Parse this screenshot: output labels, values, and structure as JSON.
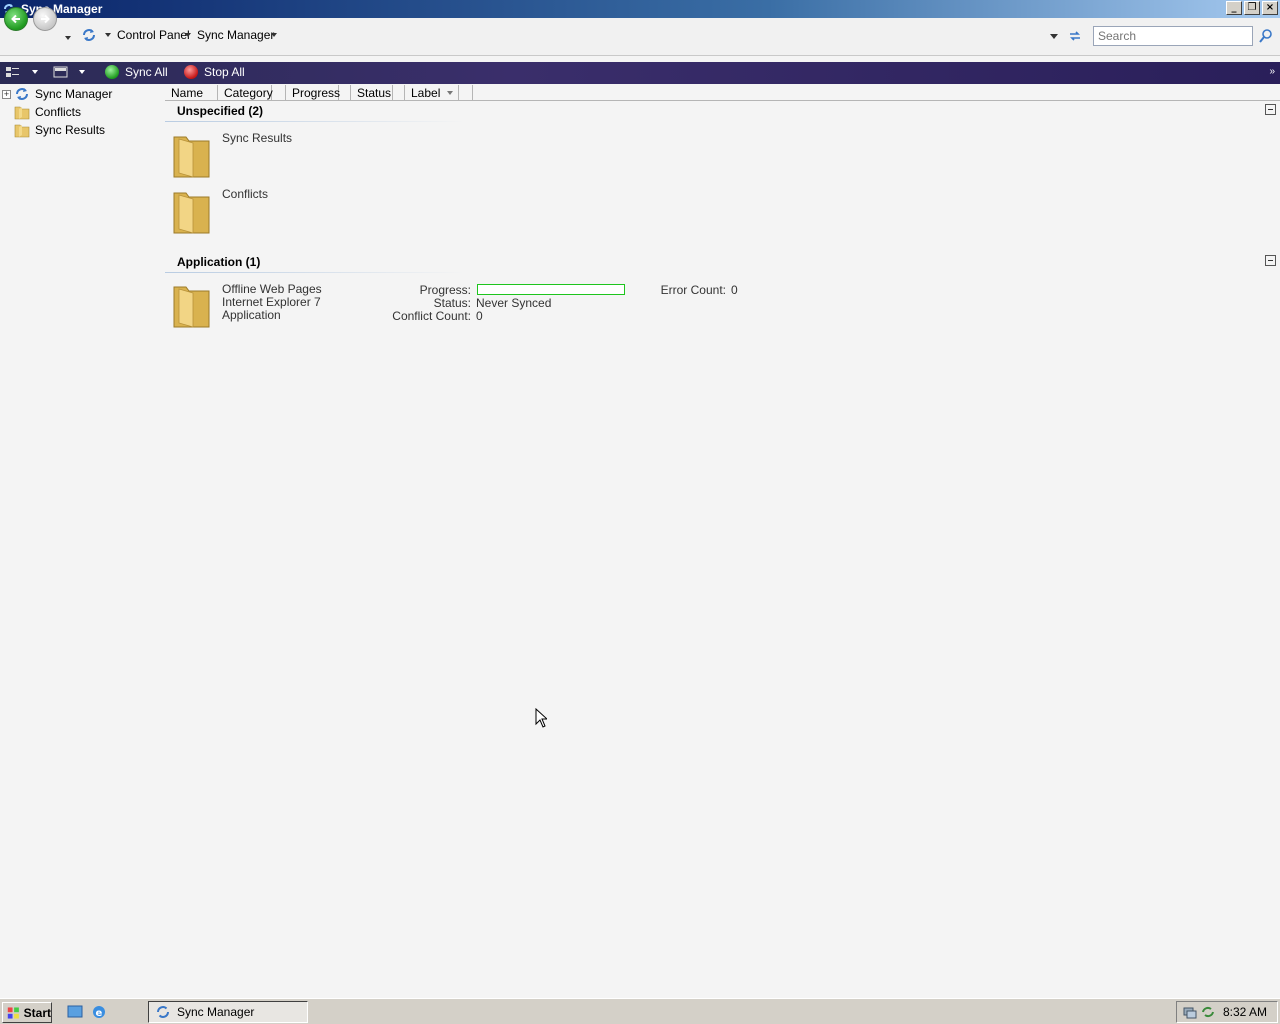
{
  "window": {
    "title": "Sync Manager",
    "controls": [
      "minimize",
      "restore",
      "close"
    ]
  },
  "address_bar": {
    "breadcrumbs": [
      "Control Panel",
      "Sync Manager"
    ],
    "search_placeholder": "Search"
  },
  "toolbar": {
    "sync_all": "Sync All",
    "stop_all": "Stop All"
  },
  "tree": {
    "items": [
      {
        "label": "Sync Manager",
        "icon": "sync-icon"
      },
      {
        "label": "Conflicts",
        "icon": "folder-icon"
      },
      {
        "label": "Sync Results",
        "icon": "folder-icon"
      }
    ]
  },
  "columns": [
    "Name",
    "Category",
    "Progress",
    "Status",
    "Label"
  ],
  "groups": {
    "unspecified": {
      "header": "Unspecified (2)",
      "items": [
        {
          "name": "Sync Results"
        },
        {
          "name": "Conflicts"
        }
      ]
    },
    "application": {
      "header": "Application (1)",
      "item": {
        "name": "Offline Web Pages",
        "subtitle": "Internet Explorer 7",
        "category": "Application",
        "progress_label": "Progress:",
        "progress_value": 0,
        "status_label": "Status:",
        "status_value": "Never Synced",
        "conflict_label": "Conflict Count:",
        "conflict_value": "0",
        "error_label": "Error Count:",
        "error_value": "0"
      }
    }
  },
  "taskbar": {
    "start": "Start",
    "task": "Sync Manager",
    "clock": "8:32 AM"
  },
  "colors": {
    "titlebar": "#0a246a",
    "progress_border": "#1ec51e",
    "toolbar": "#2b2b55"
  }
}
